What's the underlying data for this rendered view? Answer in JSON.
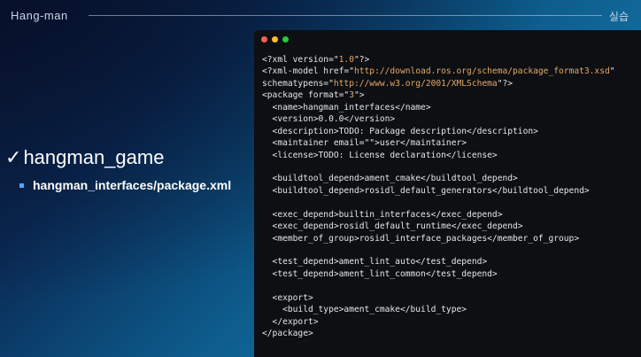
{
  "header": {
    "title": "Hang-man",
    "right_label": "실습"
  },
  "content": {
    "bullet": "hangman_game",
    "sub_bullet": "hangman_interfaces/package.xml"
  },
  "code": {
    "lines": [
      [
        {
          "t": "<?xml version=\""
        },
        {
          "t": "1.0",
          "s": 1
        },
        {
          "t": "\"?>"
        }
      ],
      [
        {
          "t": "<?xml-model href=\""
        },
        {
          "t": "http://download.ros.org/schema/package_format3.xsd",
          "s": 1
        },
        {
          "t": "\""
        }
      ],
      [
        {
          "t": "schematypens=\""
        },
        {
          "t": "http://www.w3.org/2001/XMLSchema",
          "s": 1
        },
        {
          "t": "\"?>"
        }
      ],
      [
        {
          "t": "<package format=\""
        },
        {
          "t": "3",
          "s": 1
        },
        {
          "t": "\">"
        }
      ],
      [
        {
          "t": "  <name>hangman_interfaces</name>"
        }
      ],
      [
        {
          "t": "  <version>0.0.0</version>"
        }
      ],
      [
        {
          "t": "  <description>TODO: Package description</description>"
        }
      ],
      [
        {
          "t": "  <maintainer email=\""
        },
        {
          "t": "",
          "s": 1
        },
        {
          "t": "\">user</maintainer>"
        }
      ],
      [
        {
          "t": "  <license>TODO: License declaration</license>"
        }
      ],
      [
        {
          "t": ""
        }
      ],
      [
        {
          "t": "  <buildtool_depend>ament_cmake</buildtool_depend>"
        }
      ],
      [
        {
          "t": "  <buildtool_depend>rosidl_default_generators</buildtool_depend>"
        }
      ],
      [
        {
          "t": ""
        }
      ],
      [
        {
          "t": "  <exec_depend>builtin_interfaces</exec_depend>"
        }
      ],
      [
        {
          "t": "  <exec_depend>rosidl_default_runtime</exec_depend>"
        }
      ],
      [
        {
          "t": "  <member_of_group>rosidl_interface_packages</member_of_group>"
        }
      ],
      [
        {
          "t": ""
        }
      ],
      [
        {
          "t": "  <test_depend>ament_lint_auto</test_depend>"
        }
      ],
      [
        {
          "t": "  <test_depend>ament_lint_common</test_depend>"
        }
      ],
      [
        {
          "t": ""
        }
      ],
      [
        {
          "t": "  <export>"
        }
      ],
      [
        {
          "t": "    <build_type>ament_cmake</build_type>"
        }
      ],
      [
        {
          "t": "  </export>"
        }
      ],
      [
        {
          "t": "</package>"
        }
      ]
    ]
  },
  "colors": {
    "string": "#e3a86a",
    "code_text": "#e6e6e6",
    "code_bg": "#0d0f12",
    "accent_square": "#4ea6ff"
  }
}
